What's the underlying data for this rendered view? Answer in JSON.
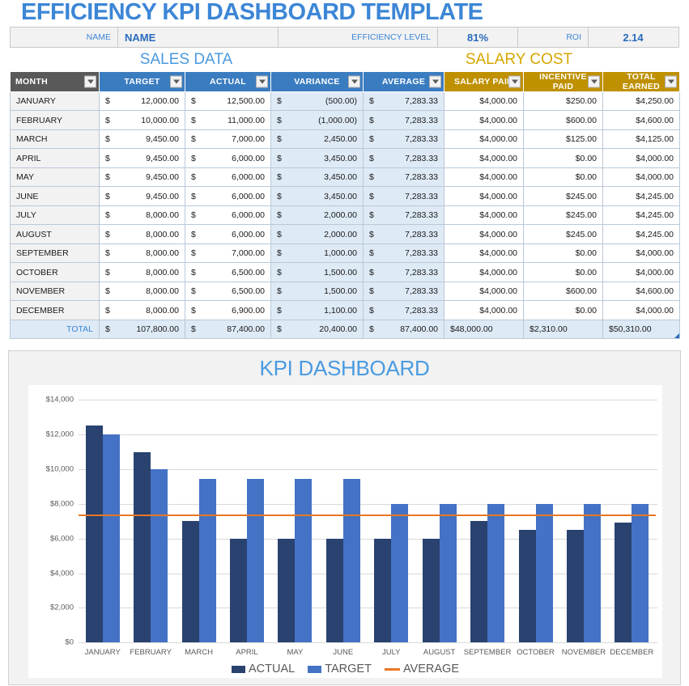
{
  "page_title": "EFFICIENCY KPI DASHBOARD TEMPLATE",
  "info_bar": {
    "name_label": "NAME",
    "name_value": "NAME",
    "efficiency_label": "EFFICIENCY LEVEL",
    "efficiency_value": "81%",
    "roi_label": "ROI",
    "roi_value": "2.14"
  },
  "sections": {
    "sales_title": "SALES DATA",
    "salary_title": "SALARY COST"
  },
  "table": {
    "headers": [
      "MONTH",
      "TARGET",
      "ACTUAL",
      "VARIANCE",
      "AVERAGE",
      "SALARY PAID",
      "INCENTIVE PAID",
      "TOTAL EARNED"
    ],
    "filter_icon": "chevron-down-icon",
    "currency_symbol": "$",
    "rows": [
      {
        "month": "JANUARY",
        "target": "12,000.00",
        "actual": "12,500.00",
        "variance": "(500.00)",
        "average": "7,283.33",
        "salary_paid": "$4,000.00",
        "incentive_paid": "$250.00",
        "total_earned": "$4,250.00"
      },
      {
        "month": "FEBRUARY",
        "target": "10,000.00",
        "actual": "11,000.00",
        "variance": "(1,000.00)",
        "average": "7,283.33",
        "salary_paid": "$4,000.00",
        "incentive_paid": "$600.00",
        "total_earned": "$4,600.00"
      },
      {
        "month": "MARCH",
        "target": "9,450.00",
        "actual": "7,000.00",
        "variance": "2,450.00",
        "average": "7,283.33",
        "salary_paid": "$4,000.00",
        "incentive_paid": "$125.00",
        "total_earned": "$4,125.00"
      },
      {
        "month": "APRIL",
        "target": "9,450.00",
        "actual": "6,000.00",
        "variance": "3,450.00",
        "average": "7,283.33",
        "salary_paid": "$4,000.00",
        "incentive_paid": "$0.00",
        "total_earned": "$4,000.00"
      },
      {
        "month": "MAY",
        "target": "9,450.00",
        "actual": "6,000.00",
        "variance": "3,450.00",
        "average": "7,283.33",
        "salary_paid": "$4,000.00",
        "incentive_paid": "$0.00",
        "total_earned": "$4,000.00"
      },
      {
        "month": "JUNE",
        "target": "9,450.00",
        "actual": "6,000.00",
        "variance": "3,450.00",
        "average": "7,283.33",
        "salary_paid": "$4,000.00",
        "incentive_paid": "$245.00",
        "total_earned": "$4,245.00"
      },
      {
        "month": "JULY",
        "target": "8,000.00",
        "actual": "6,000.00",
        "variance": "2,000.00",
        "average": "7,283.33",
        "salary_paid": "$4,000.00",
        "incentive_paid": "$245.00",
        "total_earned": "$4,245.00"
      },
      {
        "month": "AUGUST",
        "target": "8,000.00",
        "actual": "6,000.00",
        "variance": "2,000.00",
        "average": "7,283.33",
        "salary_paid": "$4,000.00",
        "incentive_paid": "$245.00",
        "total_earned": "$4,245.00"
      },
      {
        "month": "SEPTEMBER",
        "target": "8,000.00",
        "actual": "7,000.00",
        "variance": "1,000.00",
        "average": "7,283.33",
        "salary_paid": "$4,000.00",
        "incentive_paid": "$0.00",
        "total_earned": "$4,000.00"
      },
      {
        "month": "OCTOBER",
        "target": "8,000.00",
        "actual": "6,500.00",
        "variance": "1,500.00",
        "average": "7,283.33",
        "salary_paid": "$4,000.00",
        "incentive_paid": "$0.00",
        "total_earned": "$4,000.00"
      },
      {
        "month": "NOVEMBER",
        "target": "8,000.00",
        "actual": "6,500.00",
        "variance": "1,500.00",
        "average": "7,283.33",
        "salary_paid": "$4,000.00",
        "incentive_paid": "$600.00",
        "total_earned": "$4,600.00"
      },
      {
        "month": "DECEMBER",
        "target": "8,000.00",
        "actual": "6,900.00",
        "variance": "1,100.00",
        "average": "7,283.33",
        "salary_paid": "$4,000.00",
        "incentive_paid": "$0.00",
        "total_earned": "$4,000.00"
      }
    ],
    "total_row": {
      "month": "TOTAL",
      "target": "107,800.00",
      "actual": "87,400.00",
      "variance": "20,400.00",
      "average": "87,400.00",
      "salary_paid": "$48,000.00",
      "incentive_paid": "$2,310.00",
      "total_earned": "$50,310.00"
    }
  },
  "chart_data": {
    "type": "bar",
    "title": "KPI DASHBOARD",
    "xlabel": "",
    "ylabel": "",
    "ylim": [
      0,
      14000
    ],
    "ytick_labels": [
      "$14,000",
      "$12,000",
      "$10,000",
      "$8,000",
      "$6,000",
      "$4,000",
      "$2,000",
      "$0"
    ],
    "ytick_values": [
      14000,
      12000,
      10000,
      8000,
      6000,
      4000,
      2000,
      0
    ],
    "grid": true,
    "legend_position": "bottom",
    "categories": [
      "JANUARY",
      "FEBRUARY",
      "MARCH",
      "APRIL",
      "MAY",
      "JUNE",
      "JULY",
      "AUGUST",
      "SEPTEMBER",
      "OCTOBER",
      "NOVEMBER",
      "DECEMBER"
    ],
    "series": [
      {
        "name": "ACTUAL",
        "color": "#29426f",
        "values": [
          12500,
          11000,
          7000,
          6000,
          6000,
          6000,
          6000,
          6000,
          7000,
          6500,
          6500,
          6900
        ]
      },
      {
        "name": "TARGET",
        "color": "#4472c4",
        "values": [
          12000,
          10000,
          9450,
          9450,
          9450,
          9450,
          8000,
          8000,
          8000,
          8000,
          8000,
          8000
        ]
      }
    ],
    "reference_line": {
      "name": "AVERAGE",
      "color": "#e87722",
      "value": 7283.33
    }
  }
}
